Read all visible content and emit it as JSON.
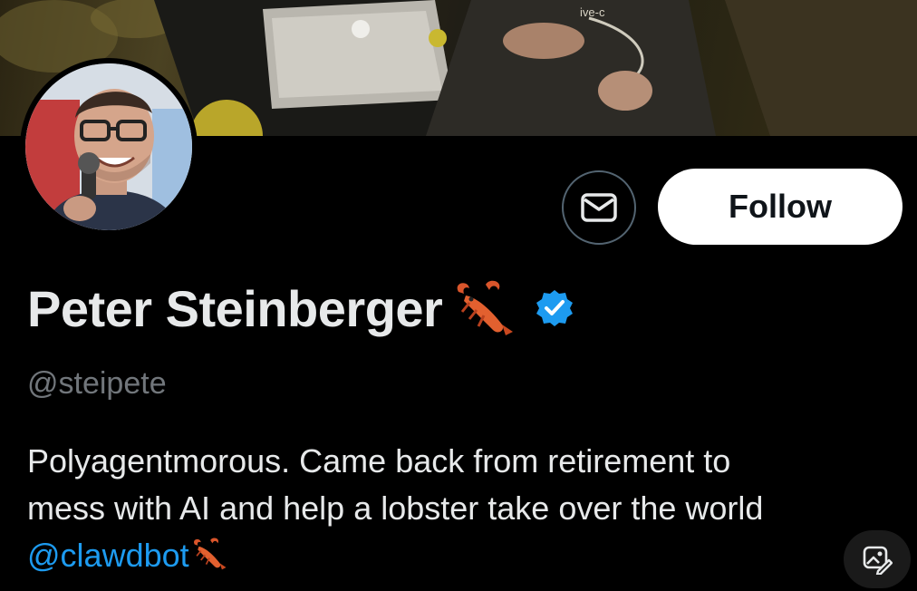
{
  "profile": {
    "display_name": "Peter Steinberger",
    "handle": "@steipete",
    "verified": true,
    "name_emoji": "lobster-icon",
    "bio_line1": "Polyagentmorous. Came back from retirement to",
    "bio_line2": "mess with AI and help a lobster take over the world",
    "bio_mention": "@clawdbot"
  },
  "actions": {
    "message_icon": "envelope-icon",
    "follow_label": "Follow"
  },
  "banner": {
    "shirt_text": "ive-c"
  },
  "colors": {
    "background": "#000000",
    "text_primary": "#e7e9ea",
    "text_secondary": "#71767b",
    "link": "#1d9bf0",
    "verified": "#1d9bf0",
    "follow_bg": "#ffffff"
  }
}
